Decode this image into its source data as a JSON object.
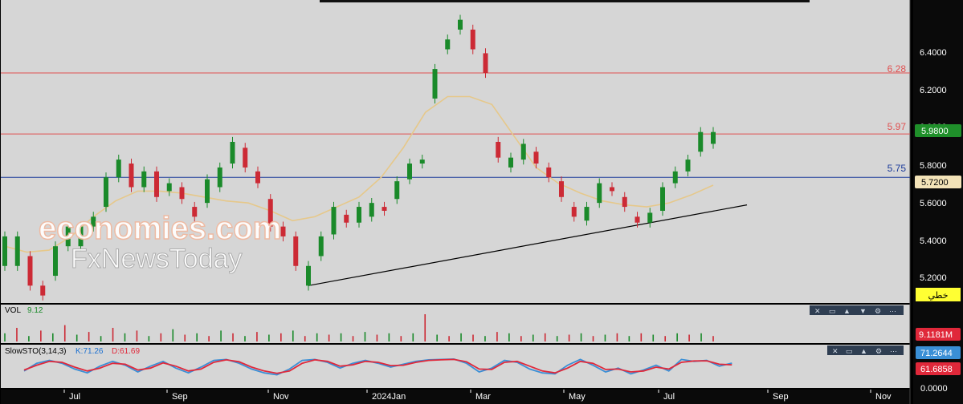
{
  "chart_data": {
    "type": "candlestick",
    "x_ticks": [
      "Jul",
      "Sep",
      "Nov",
      "2024Jan",
      "Mar",
      "May",
      "Jul",
      "Sep",
      "Nov"
    ],
    "price_axis": {
      "ticks": [
        "6.4000",
        "6.2000",
        "6.0000",
        "5.8000",
        "5.6000",
        "5.4000",
        "5.2000"
      ],
      "ylim": [
        5.12,
        6.63
      ],
      "last_price_label": "5.9800",
      "ma_label": "5.7200",
      "trendline_button": "خطي"
    },
    "levels": [
      {
        "label": "6.28",
        "value": 6.28,
        "color": "#e05050"
      },
      {
        "label": "5.97",
        "value": 5.97,
        "color": "#e05050"
      },
      {
        "label": "5.75",
        "value": 5.75,
        "color": "#1a3a9a"
      }
    ],
    "trendline": {
      "start": 5.2,
      "end": 5.61
    },
    "candles": [
      [
        5.3,
        5.45
      ],
      [
        5.3,
        5.45
      ],
      [
        5.35,
        5.2
      ],
      [
        5.2,
        5.15
      ],
      [
        5.25,
        5.4
      ],
      [
        5.4,
        5.5
      ],
      [
        5.4,
        5.5
      ],
      [
        5.5,
        5.55
      ],
      [
        5.6,
        5.75
      ],
      [
        5.75,
        5.84
      ],
      [
        5.82,
        5.7
      ],
      [
        5.7,
        5.78
      ],
      [
        5.78,
        5.65
      ],
      [
        5.68,
        5.72
      ],
      [
        5.7,
        5.64
      ],
      [
        5.6,
        5.55
      ],
      [
        5.62,
        5.74
      ],
      [
        5.7,
        5.8
      ],
      [
        5.82,
        5.93
      ],
      [
        5.9,
        5.8
      ],
      [
        5.78,
        5.72
      ],
      [
        5.64,
        5.5
      ],
      [
        5.5,
        5.45
      ],
      [
        5.45,
        5.3
      ],
      [
        5.2,
        5.3
      ],
      [
        5.35,
        5.45
      ],
      [
        5.46,
        5.6
      ],
      [
        5.56,
        5.52
      ],
      [
        5.52,
        5.6
      ],
      [
        5.55,
        5.62
      ],
      [
        5.6,
        5.58
      ],
      [
        5.64,
        5.73
      ],
      [
        5.74,
        5.82
      ],
      [
        5.82,
        5.84
      ],
      [
        6.15,
        6.3
      ],
      [
        6.4,
        6.45
      ],
      [
        6.5,
        6.55
      ],
      [
        6.5,
        6.4
      ],
      [
        6.38,
        6.28
      ],
      [
        5.93,
        5.85
      ],
      [
        5.8,
        5.85
      ],
      [
        5.84,
        5.92
      ],
      [
        5.88,
        5.82
      ],
      [
        5.8,
        5.75
      ],
      [
        5.73,
        5.65
      ],
      [
        5.6,
        5.55
      ],
      [
        5.53,
        5.6
      ],
      [
        5.62,
        5.72
      ],
      [
        5.7,
        5.68
      ],
      [
        5.65,
        5.6
      ],
      [
        5.55,
        5.52
      ],
      [
        5.52,
        5.57
      ],
      [
        5.58,
        5.7
      ],
      [
        5.72,
        5.78
      ],
      [
        5.78,
        5.84
      ],
      [
        5.88,
        5.98
      ],
      [
        5.92,
        5.98
      ]
    ],
    "ma": [
      5.4,
      5.37,
      5.38,
      5.45,
      5.55,
      5.63,
      5.68,
      5.68,
      5.67,
      5.65,
      5.63,
      5.62,
      5.58,
      5.53,
      5.55,
      5.6,
      5.65,
      5.75,
      5.9,
      6.08,
      6.16,
      6.16,
      6.12,
      5.96,
      5.8,
      5.72,
      5.67,
      5.63,
      5.61,
      5.6,
      5.62,
      5.66,
      5.71
    ],
    "vol_panel": {
      "label": "VOL",
      "value": "9.12",
      "axis_label": "9.1181M",
      "values": [
        0.3,
        0.5,
        0.2,
        0.4,
        0.3,
        0.6,
        0.25,
        0.35,
        0.2,
        0.5,
        0.3,
        0.4,
        0.2,
        0.3,
        0.45,
        0.25,
        0.3,
        0.2,
        0.4,
        0.3,
        0.2,
        0.35,
        0.25,
        0.3,
        0.4,
        0.2,
        0.3,
        0.25,
        0.3,
        0.2,
        0.35,
        0.25,
        0.3,
        0.2,
        0.3,
        1.0,
        0.25,
        0.2,
        0.3,
        0.25,
        0.2,
        0.35,
        0.3,
        0.2,
        0.25,
        0.3,
        0.2,
        0.25,
        0.3,
        0.2,
        0.25,
        0.3,
        0.2,
        0.3,
        0.25,
        0.2,
        0.3,
        0.25,
        0.3,
        0.2
      ]
    },
    "sto_panel": {
      "label": "SlowSTO(3,14,3)",
      "k_label": "K:71.26",
      "d_label": "D:61.69",
      "k_axis": "71.2644",
      "d_axis": "61.6858",
      "bottom_axis": "0.0000",
      "k": [
        30,
        70,
        85,
        70,
        40,
        20,
        55,
        80,
        60,
        25,
        55,
        80,
        45,
        20,
        50,
        85,
        90,
        70,
        40,
        20,
        10,
        40,
        85,
        90,
        75,
        45,
        70,
        85,
        70,
        50,
        65,
        80,
        88,
        90,
        92,
        70,
        25,
        45,
        85,
        75,
        40,
        20,
        15,
        60,
        90,
        60,
        25,
        45,
        15,
        35,
        60,
        30,
        90,
        80,
        85,
        55,
        71
      ],
      "d": [
        35,
        60,
        80,
        75,
        50,
        30,
        45,
        70,
        65,
        35,
        45,
        72,
        55,
        30,
        40,
        75,
        88,
        78,
        50,
        30,
        18,
        30,
        70,
        88,
        80,
        55,
        62,
        80,
        75,
        58,
        60,
        75,
        85,
        88,
        90,
        78,
        40,
        38,
        75,
        80,
        55,
        30,
        20,
        45,
        80,
        70,
        38,
        40,
        25,
        30,
        50,
        40,
        75,
        82,
        83,
        65,
        62
      ]
    }
  },
  "watermark": {
    "line1": "economies.com",
    "line2": "FxNewsToday"
  },
  "colors": {
    "up": "#1a8a2a",
    "down": "#cc2a35",
    "ma": "#e6c88a",
    "bg": "#d6d6d6",
    "k": "#3a8fd6",
    "d": "#e0283a"
  }
}
